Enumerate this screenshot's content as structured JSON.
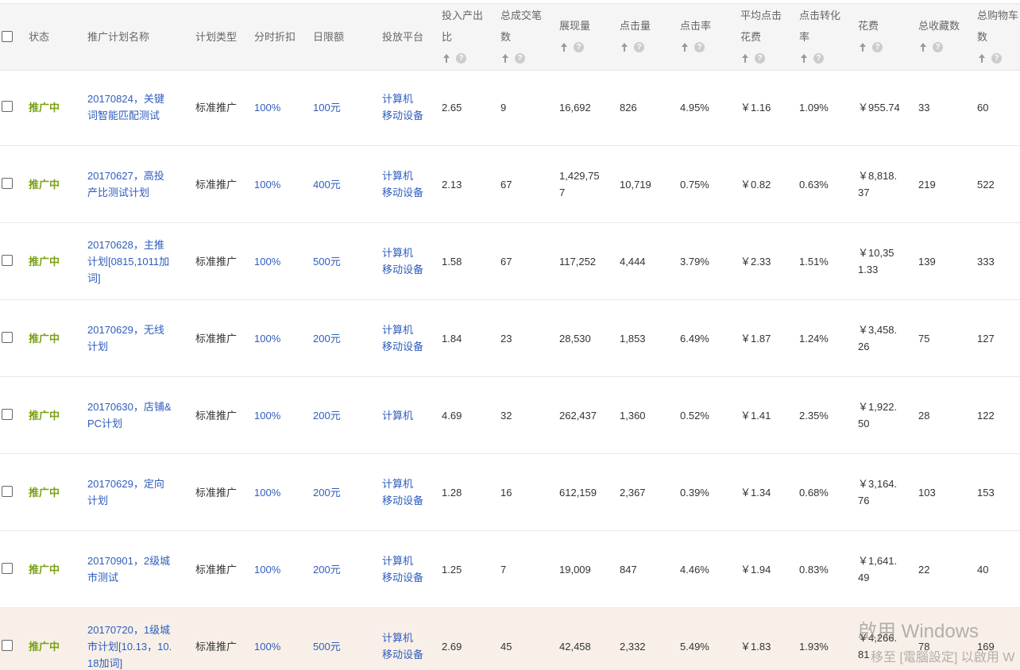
{
  "header": {
    "status": "状态",
    "plan_name": "推广计划名称",
    "plan_type": "计划类型",
    "time_discount": "分时折扣",
    "daily_limit": "日限额",
    "platform": "投放平台",
    "roi_l1": "投入产出",
    "roi_l2": "比",
    "total_deals_l1": "总成交笔",
    "total_deals_l2": "数",
    "impressions": "展现量",
    "clicks": "点击量",
    "ctr": "点击率",
    "avg_cpc_l1": "平均点击",
    "avg_cpc_l2": "花费",
    "cvr_l1": "点击转化",
    "cvr_l2": "率",
    "cost": "花费",
    "favorites": "总收藏数",
    "cart_l1": "总购物车",
    "cart_l2": "数"
  },
  "rows": [
    {
      "status": "推广中",
      "name_l1": "20170824，关键",
      "name_l2": "词智能匹配测试",
      "name_l3": "",
      "type": "标准推广",
      "discount": "100%",
      "limit": "100元",
      "platform_l1": "计算机",
      "platform_l2": "移动设备",
      "roi": "2.65",
      "deals": "9",
      "impr_l1": "16,692",
      "impr_l2": "",
      "clicks": "826",
      "ctr": "4.95%",
      "cpc": "￥1.16",
      "cvr": "1.09%",
      "cost_l1": "￥955.74",
      "cost_l2": "",
      "fav": "33",
      "cart": "60"
    },
    {
      "status": "推广中",
      "name_l1": "20170627，高投",
      "name_l2": "产比测试计划",
      "name_l3": "",
      "type": "标准推广",
      "discount": "100%",
      "limit": "400元",
      "platform_l1": "计算机",
      "platform_l2": "移动设备",
      "roi": "2.13",
      "deals": "67",
      "impr_l1": "1,429,75",
      "impr_l2": "7",
      "clicks": "10,719",
      "ctr": "0.75%",
      "cpc": "￥0.82",
      "cvr": "0.63%",
      "cost_l1": "￥8,818.",
      "cost_l2": "37",
      "fav": "219",
      "cart": "522"
    },
    {
      "status": "推广中",
      "name_l1": "20170628，主推",
      "name_l2": "计划[0815,1011加",
      "name_l3": "词]",
      "type": "标准推广",
      "discount": "100%",
      "limit": "500元",
      "platform_l1": "计算机",
      "platform_l2": "移动设备",
      "roi": "1.58",
      "deals": "67",
      "impr_l1": "117,252",
      "impr_l2": "",
      "clicks": "4,444",
      "ctr": "3.79%",
      "cpc": "￥2.33",
      "cvr": "1.51%",
      "cost_l1": "￥10,35",
      "cost_l2": "1.33",
      "fav": "139",
      "cart": "333"
    },
    {
      "status": "推广中",
      "name_l1": "20170629，无线",
      "name_l2": "计划",
      "name_l3": "",
      "type": "标准推广",
      "discount": "100%",
      "limit": "200元",
      "platform_l1": "计算机",
      "platform_l2": "移动设备",
      "roi": "1.84",
      "deals": "23",
      "impr_l1": "28,530",
      "impr_l2": "",
      "clicks": "1,853",
      "ctr": "6.49%",
      "cpc": "￥1.87",
      "cvr": "1.24%",
      "cost_l1": "￥3,458.",
      "cost_l2": "26",
      "fav": "75",
      "cart": "127"
    },
    {
      "status": "推广中",
      "name_l1": "20170630，店铺&",
      "name_l2": "PC计划",
      "name_l3": "",
      "type": "标准推广",
      "discount": "100%",
      "limit": "200元",
      "platform_l1": "计算机",
      "platform_l2": "",
      "roi": "4.69",
      "deals": "32",
      "impr_l1": "262,437",
      "impr_l2": "",
      "clicks": "1,360",
      "ctr": "0.52%",
      "cpc": "￥1.41",
      "cvr": "2.35%",
      "cost_l1": "￥1,922.",
      "cost_l2": "50",
      "fav": "28",
      "cart": "122"
    },
    {
      "status": "推广中",
      "name_l1": "20170629，定向",
      "name_l2": "计划",
      "name_l3": "",
      "type": "标准推广",
      "discount": "100%",
      "limit": "200元",
      "platform_l1": "计算机",
      "platform_l2": "移动设备",
      "roi": "1.28",
      "deals": "16",
      "impr_l1": "612,159",
      "impr_l2": "",
      "clicks": "2,367",
      "ctr": "0.39%",
      "cpc": "￥1.34",
      "cvr": "0.68%",
      "cost_l1": "￥3,164.",
      "cost_l2": "76",
      "fav": "103",
      "cart": "153"
    },
    {
      "status": "推广中",
      "name_l1": "20170901，2级城",
      "name_l2": "市测试",
      "name_l3": "",
      "type": "标准推广",
      "discount": "100%",
      "limit": "200元",
      "platform_l1": "计算机",
      "platform_l2": "移动设备",
      "roi": "1.25",
      "deals": "7",
      "impr_l1": "19,009",
      "impr_l2": "",
      "clicks": "847",
      "ctr": "4.46%",
      "cpc": "￥1.94",
      "cvr": "0.83%",
      "cost_l1": "￥1,641.",
      "cost_l2": "49",
      "fav": "22",
      "cart": "40"
    },
    {
      "status": "推广中",
      "name_l1": "20170720，1级城",
      "name_l2": "市计划[10.13，10.",
      "name_l3": "18加词]",
      "type": "标准推广",
      "discount": "100%",
      "limit": "500元",
      "platform_l1": "计算机",
      "platform_l2": "移动设备",
      "roi": "2.69",
      "deals": "45",
      "impr_l1": "42,458",
      "impr_l2": "",
      "clicks": "2,332",
      "ctr": "5.49%",
      "cpc": "￥1.83",
      "cvr": "1.93%",
      "cost_l1": "￥4,266.",
      "cost_l2": "81",
      "fav": "78",
      "cart": "169"
    }
  ],
  "watermark": {
    "line1": "啟用 Windows",
    "line2": "移至 [電腦設定] 以啟用 W"
  }
}
